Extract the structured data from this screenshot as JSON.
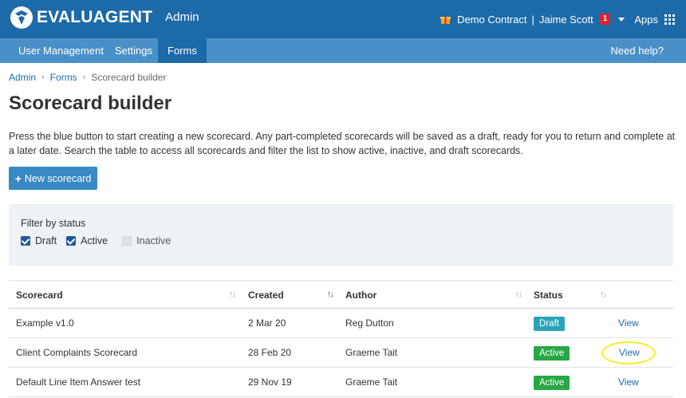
{
  "header": {
    "brand": "EVALUAGENT",
    "section": "Admin",
    "contract": "Demo Contract",
    "separator": "|",
    "user": "Jaime Scott",
    "notifications": "1",
    "apps_label": "Apps",
    "icons": {
      "logo": "evaluagent-logo-icon",
      "gift": "gift-icon",
      "caret": "caret-down-icon",
      "apps": "grid-icon"
    },
    "colors": {
      "topbar": "#1d6aa8",
      "navbar": "#4a90c8",
      "badge": "#d9232d",
      "gift": "#f2a516"
    }
  },
  "nav": {
    "items": [
      {
        "label": "User Management"
      },
      {
        "label": "Settings"
      },
      {
        "label": "Forms"
      }
    ],
    "active": "Forms",
    "help": "Need help?"
  },
  "breadcrumb": {
    "items": [
      "Admin",
      "Forms",
      "Scorecard builder"
    ],
    "separator": "›"
  },
  "page": {
    "title": "Scorecard builder",
    "intro": "Press the blue button to start creating a new scorecard. Any part-completed scorecards will be saved as a draft, ready for you to return and complete at a later date. Search the table to access all scorecards and filter the list to show active, inactive, and draft scorecards.",
    "new_button": "New scorecard",
    "new_button_icon": "+"
  },
  "filter": {
    "label": "Filter by status",
    "options": [
      {
        "label": "Draft",
        "checked": true
      },
      {
        "label": "Active",
        "checked": true
      },
      {
        "label": "Inactive",
        "checked": false
      }
    ]
  },
  "table": {
    "headers": [
      "Scorecard",
      "Created",
      "Author",
      "Status"
    ],
    "sort_glyph": "↑↓",
    "rows": [
      {
        "scorecard": "Example v1.0",
        "created": "2 Mar 20",
        "author": "Reg Dutton",
        "status": "Draft",
        "action": "View"
      },
      {
        "scorecard": "Client Complaints Scorecard",
        "created": "28 Feb 20",
        "author": "Graeme Tait",
        "status": "Active",
        "action": "View"
      },
      {
        "scorecard": "Default Line Item Answer test",
        "created": "29 Nov 19",
        "author": "Graeme Tait",
        "status": "Active",
        "action": "View"
      }
    ],
    "status_colors": {
      "Draft": "#2aa3b8",
      "Active": "#27a844"
    }
  }
}
